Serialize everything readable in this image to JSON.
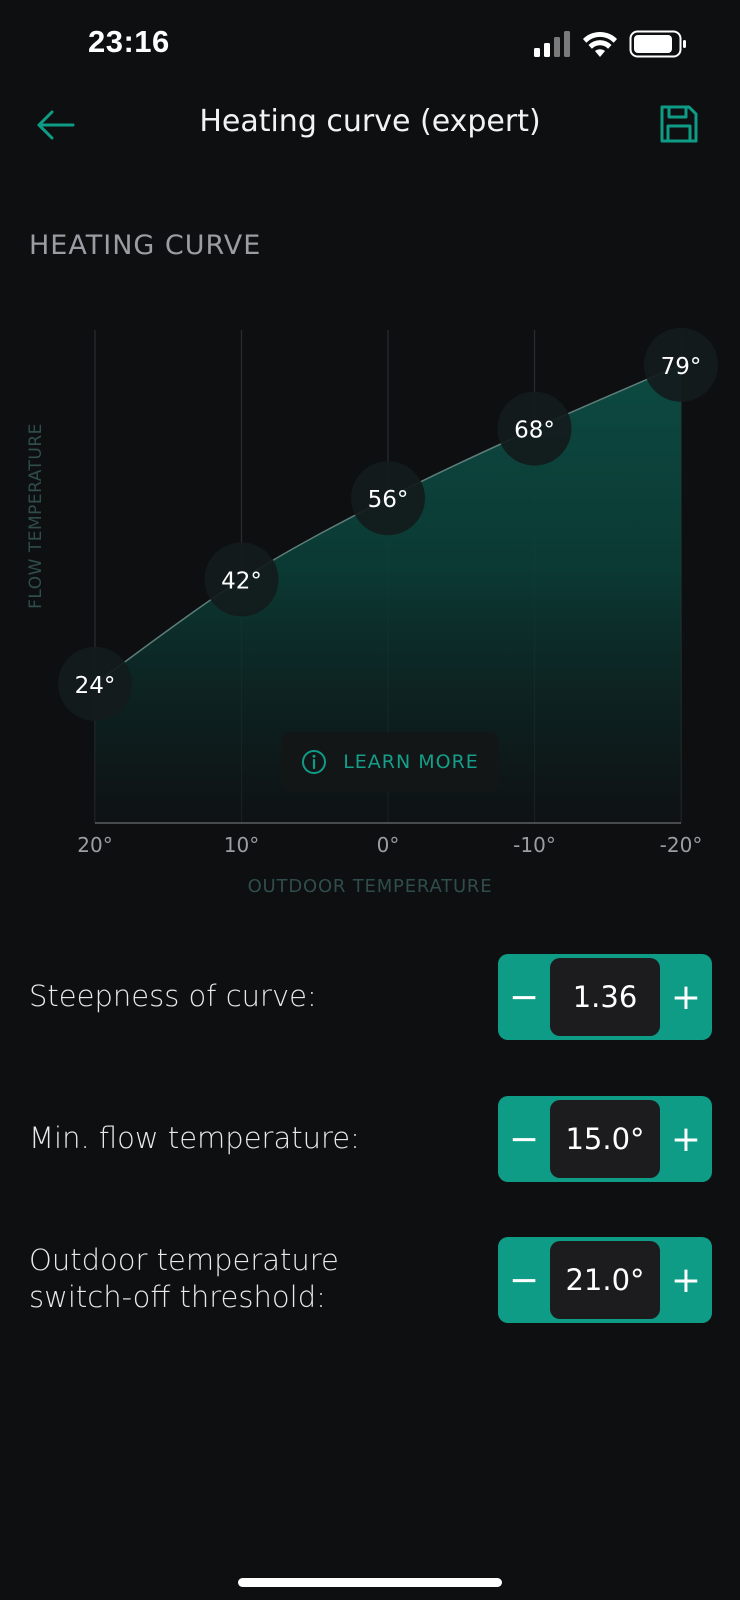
{
  "status_bar": {
    "time": "23:16",
    "icons": [
      "cellular-signal-icon",
      "wifi-icon",
      "battery-icon"
    ]
  },
  "header": {
    "title": "Heating curve (expert)",
    "back_icon": "arrow-left-icon",
    "save_icon": "floppy-disk-icon"
  },
  "section": {
    "title": "HEATING CURVE"
  },
  "chart_data": {
    "type": "area",
    "xlabel": "OUTDOOR TEMPERATURE",
    "ylabel": "FLOW TEMPERATURE",
    "x": [
      20,
      10,
      0,
      -10,
      -20
    ],
    "x_tick_labels": [
      "20°",
      "10°",
      "0°",
      "-10°",
      "-20°"
    ],
    "series": [
      {
        "values": [
          24,
          42,
          56,
          68,
          79
        ],
        "labels": [
          "24°",
          "42°",
          "56°",
          "68°",
          "79°"
        ]
      }
    ],
    "ylim": [
      0,
      85
    ],
    "grid": "vertical",
    "accent_color": "#0f9c87"
  },
  "learn_more": {
    "label": "LEARN MORE",
    "icon": "info-circle-icon"
  },
  "settings": [
    {
      "label": "Steepness of curve:",
      "value": "1.36",
      "minus": "−",
      "plus": "+"
    },
    {
      "label": "Min. flow temperature:",
      "value": "15.0°",
      "minus": "−",
      "plus": "+"
    },
    {
      "label": "Outdoor temperature\nswitch-off threshold:",
      "value": "21.0°",
      "minus": "−",
      "plus": "+"
    }
  ],
  "colors": {
    "background": "#0e0f11",
    "accent": "#0f9c87",
    "stepper_value_bg": "#1c1c1e"
  }
}
